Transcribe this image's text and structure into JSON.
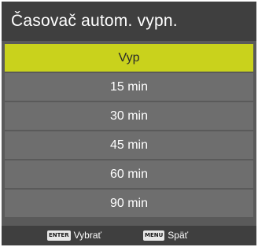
{
  "title": "Časovač autom. vypn.",
  "options": [
    "Vyp",
    "15 min",
    "30 min",
    "45 min",
    "60 min",
    "90 min"
  ],
  "selected_index": 0,
  "footer": {
    "enter_key": "ENTER",
    "enter_label": "Vybrať",
    "menu_key": "MENU",
    "menu_label": "Späť"
  },
  "colors": {
    "panel_bg": "#5a5a5a",
    "title_bg": "#3f3f3f",
    "item_bg": "#6e6e6e",
    "selected_bg": "#c9d21c"
  }
}
